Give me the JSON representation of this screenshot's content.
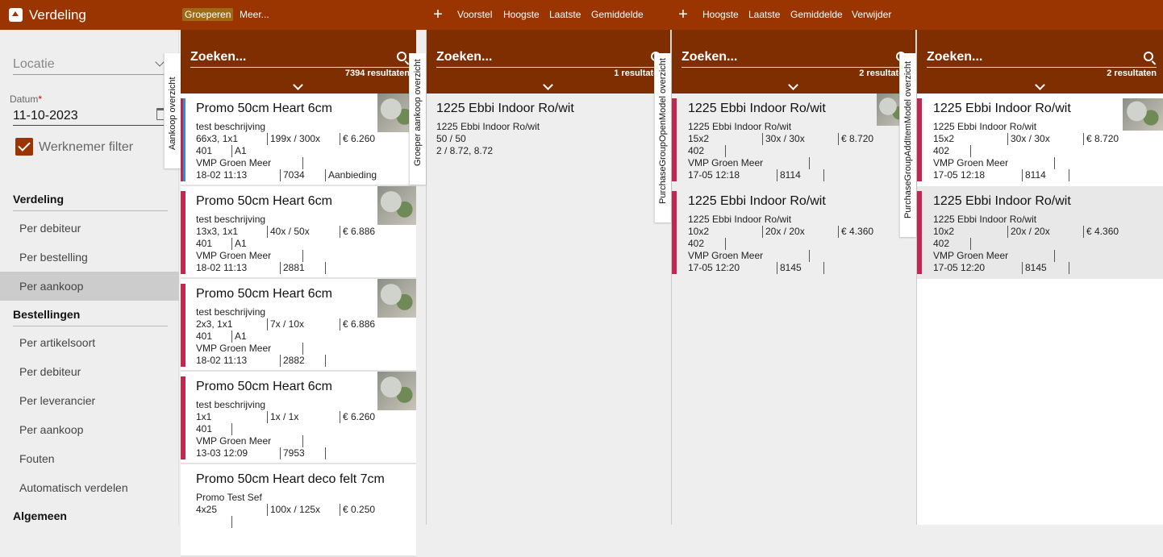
{
  "app": {
    "title": "Verdeling"
  },
  "toolbar": {
    "group1": [
      "Groeperen",
      "Meer..."
    ],
    "group2": [
      "Voorstel",
      "Hoogste",
      "Laatste",
      "Gemiddelde"
    ],
    "group3": [
      "Hoogste",
      "Laatste",
      "Gemiddelde",
      "Verwijder"
    ],
    "plus": "+"
  },
  "sidebar": {
    "location_placeholder": "Locatie",
    "date_label": "Datum",
    "date_required": "*",
    "date_value": "11-10-2023",
    "employee_filter": "Werknemer filter",
    "sections": [
      {
        "title": "Verdeling",
        "items": [
          "Per debiteur",
          "Per bestelling",
          "Per aankoop"
        ]
      },
      {
        "title": "Bestellingen",
        "items": [
          "Per artikelsoort",
          "Per debiteur",
          "Per leverancier",
          "Per aankoop",
          "Fouten",
          "Automatisch verdelen"
        ]
      },
      {
        "title": "Algemeen",
        "items": []
      }
    ]
  },
  "panels": [
    {
      "tab": "Aankoop overzicht",
      "search": "Zoeken...",
      "count": "7394 resultaten",
      "cards": [
        {
          "title": "Promo 50cm Heart 6cm",
          "desc": "test beschrijving",
          "r1": [
            "66x3, 1x1",
            "199x / 300x",
            "€ 6.260"
          ],
          "r2": [
            "401",
            "A1"
          ],
          "r3": [
            "VMP Groen Meer",
            ""
          ],
          "r4": [
            "18-02 11:13",
            "7034",
            "Aanbieding"
          ]
        },
        {
          "title": "Promo 50cm Heart 6cm",
          "desc": "test beschrijving",
          "r1": [
            "13x3, 1x1",
            "40x / 50x",
            "€ 6.886"
          ],
          "r2": [
            "401",
            "A1"
          ],
          "r3": [
            "VMP Groen Meer",
            ""
          ],
          "r4": [
            "18-02 11:13",
            "2881",
            ""
          ]
        },
        {
          "title": "Promo 50cm Heart 6cm",
          "desc": "test beschrijving",
          "r1": [
            "2x3, 1x1",
            "7x / 10x",
            "€ 6.886"
          ],
          "r2": [
            "401",
            "A1"
          ],
          "r3": [
            "VMP Groen Meer",
            ""
          ],
          "r4": [
            "18-02 11:13",
            "2882",
            ""
          ]
        },
        {
          "title": "Promo 50cm Heart 6cm",
          "desc": "test beschrijving",
          "r1": [
            "1x1",
            "1x / 1x",
            "€ 6.260"
          ],
          "r2": [
            "401",
            ""
          ],
          "r3": [
            "VMP Groen Meer",
            ""
          ],
          "r4": [
            "13-03 12:09",
            "7953",
            ""
          ]
        },
        {
          "title": "Promo 50cm Heart deco felt 7cm",
          "desc": "Promo Test Sef",
          "r1": [
            "4x25",
            "100x / 125x",
            "€ 0.250"
          ],
          "r2": [
            "",
            ""
          ],
          "r3": [
            "",
            ""
          ],
          "r4": [
            "",
            "",
            ""
          ]
        }
      ]
    },
    {
      "tab": "Groeper aankoop overzicht",
      "search": "Zoeken...",
      "count": "1 resultaten",
      "cards": [
        {
          "title": "1225 Ebbi Indoor Ro/wit",
          "lines": [
            "1225 Ebbi Indoor Ro/wit",
            "50 / 50",
            "2 / 8.72, 8.72"
          ]
        }
      ]
    },
    {
      "tab": "PurchaseGroupOpenModel overzicht",
      "search": "Zoeken...",
      "count": "2 resultaten",
      "cards": [
        {
          "title": "1225 Ebbi Indoor Ro/wit",
          "desc": "1225 Ebbi Indoor Ro/wit",
          "r1": [
            "15x2",
            "30x / 30x",
            "€ 8.720"
          ],
          "r2": [
            "402",
            ""
          ],
          "r3": [
            "VMP Groen Meer",
            ""
          ],
          "r4": [
            "17-05 12:18",
            "8114",
            ""
          ]
        },
        {
          "title": "1225 Ebbi Indoor Ro/wit",
          "desc": "1225 Ebbi Indoor Ro/wit",
          "r1": [
            "10x2",
            "20x / 20x",
            "€ 4.360"
          ],
          "r2": [
            "402",
            ""
          ],
          "r3": [
            "VMP Groen Meer",
            ""
          ],
          "r4": [
            "17-05 12:20",
            "8145",
            ""
          ]
        }
      ]
    },
    {
      "tab": "PurchaseGroupAddItemModel overzicht",
      "search": "Zoeken...",
      "count": "2 resultaten",
      "cards": [
        {
          "title": "1225 Ebbi Indoor Ro/wit",
          "desc": "1225 Ebbi Indoor Ro/wit",
          "r1": [
            "15x2",
            "30x / 30x",
            "€ 8.720"
          ],
          "r2": [
            "402",
            ""
          ],
          "r3": [
            "VMP Groen Meer",
            ""
          ],
          "r4": [
            "17-05 12:18",
            "8114",
            ""
          ]
        },
        {
          "title": "1225 Ebbi Indoor Ro/wit",
          "desc": "1225 Ebbi Indoor Ro/wit",
          "r1": [
            "10x2",
            "20x / 20x",
            "€ 4.360"
          ],
          "r2": [
            "402",
            ""
          ],
          "r3": [
            "VMP Groen Meer",
            ""
          ],
          "r4": [
            "17-05 12:20",
            "8145",
            ""
          ]
        }
      ]
    }
  ]
}
